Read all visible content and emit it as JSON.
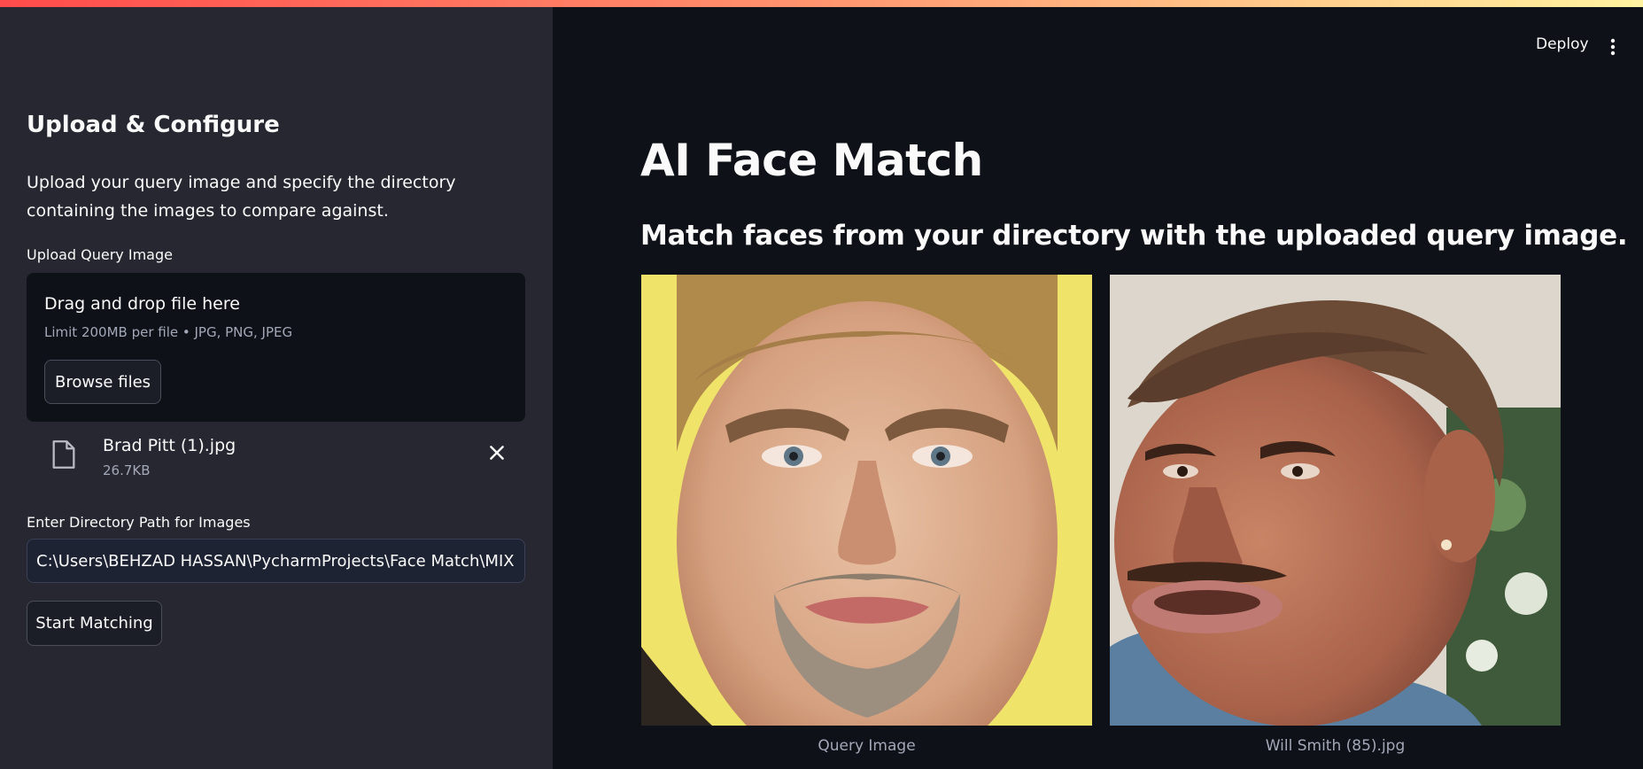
{
  "sidebar": {
    "title": "Upload & Configure",
    "description": "Upload your query image and specify the directory containing the images to compare against.",
    "upload_label": "Upload Query Image",
    "dropzone": {
      "title": "Drag and drop file here",
      "limit": "Limit 200MB per file • JPG, PNG, JPEG",
      "browse_label": "Browse files"
    },
    "uploaded_file": {
      "name": "Brad Pitt (1).jpg",
      "size": "26.7KB"
    },
    "directory_label": "Enter Directory Path for Images",
    "directory_value": "C:\\Users\\BEHZAD HASSAN\\PycharmProjects\\Face Match\\MIX",
    "start_label": "Start Matching"
  },
  "header": {
    "deploy_label": "Deploy",
    "menu_icon": "kebab-menu-icon"
  },
  "main": {
    "title": "AI Face Match",
    "subtitle": "Match faces from your directory with the uploaded query image.",
    "images": [
      {
        "caption": "Query Image"
      },
      {
        "caption": "Will Smith (85).jpg"
      }
    ]
  },
  "colors": {
    "sidebar_bg": "#262730",
    "main_bg": "#0e1117",
    "text": "#fafafa",
    "muted": "#a3a8b8",
    "accent_top_line": "#ff4b4b"
  }
}
